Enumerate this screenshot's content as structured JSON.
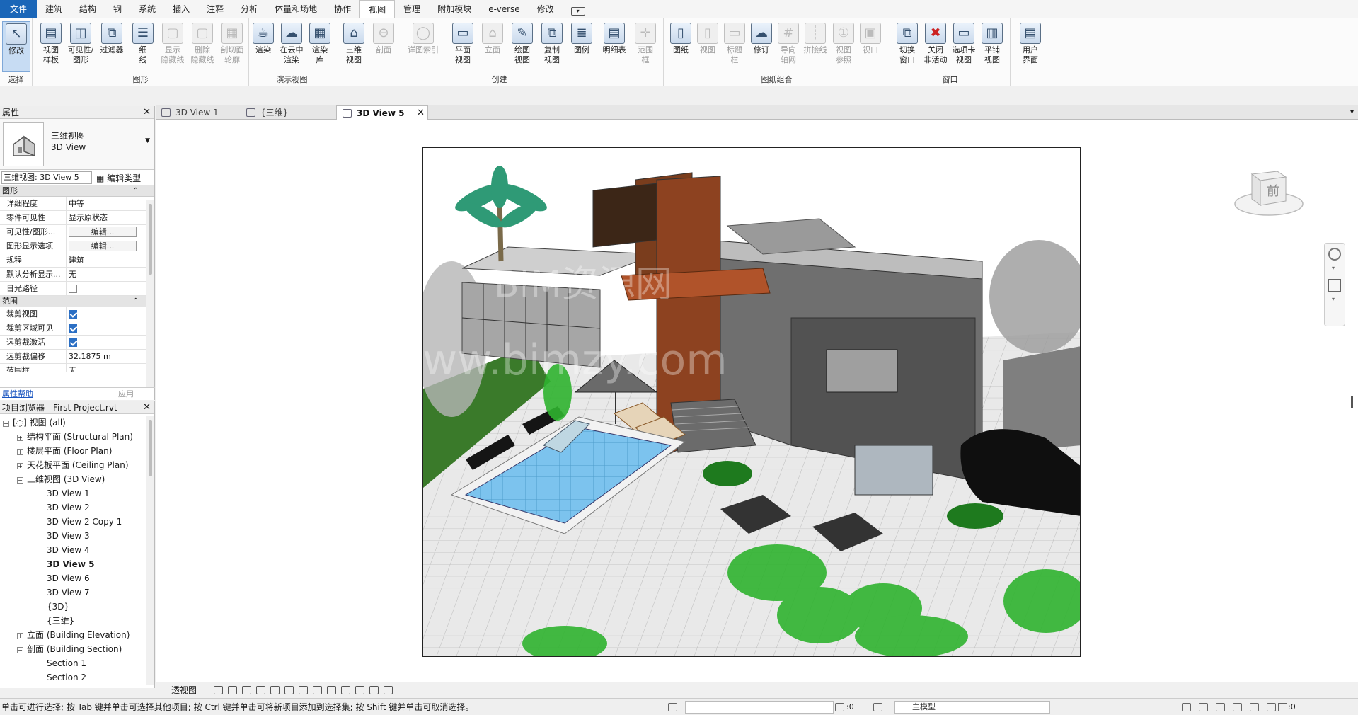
{
  "menu": {
    "file": "文件",
    "tabs": [
      "建筑",
      "结构",
      "钢",
      "系统",
      "插入",
      "注释",
      "分析",
      "体量和场地",
      "协作",
      "视图",
      "管理",
      "附加模块",
      "e-verse",
      "修改"
    ],
    "active": "视图"
  },
  "ribbon": {
    "buttons": [
      {
        "label": "修改",
        "sub": "",
        "icon": "cursor-icon"
      },
      {
        "label": "视图",
        "sub": "样板",
        "icon": "view-template-icon"
      },
      {
        "label": "可见性/",
        "sub": "图形",
        "icon": "visibility-graphics-icon"
      },
      {
        "label": "过滤器",
        "sub": "",
        "icon": "filters-icon"
      },
      {
        "label": "细",
        "sub": "线",
        "icon": "thin-lines-icon"
      },
      {
        "label": "显示",
        "sub": "隐藏线",
        "icon": "show-hidden-lines-icon"
      },
      {
        "label": "删除",
        "sub": "隐藏线",
        "icon": "remove-hidden-lines-icon"
      },
      {
        "label": "剖切面",
        "sub": "轮廓",
        "icon": "cut-profile-icon"
      },
      {
        "label": "渲染",
        "sub": "",
        "icon": "render-teapot-icon"
      },
      {
        "label": "在云中",
        "sub": "渲染",
        "icon": "cloud-render-icon"
      },
      {
        "label": "渲染",
        "sub": "库",
        "icon": "render-gallery-icon"
      },
      {
        "label": "三维",
        "sub": "视图",
        "icon": "3d-view-house-icon"
      },
      {
        "label": "剖面",
        "sub": "",
        "icon": "section-icon"
      },
      {
        "label": "详图索引",
        "sub": "",
        "icon": "callout-icon"
      },
      {
        "label": "平面",
        "sub": "视图",
        "icon": "plan-view-icon"
      },
      {
        "label": "立面",
        "sub": "",
        "icon": "elevation-icon"
      },
      {
        "label": "绘图",
        "sub": "视图",
        "icon": "drafting-view-icon"
      },
      {
        "label": "复制",
        "sub": "视图",
        "icon": "duplicate-view-icon"
      },
      {
        "label": "图例",
        "sub": "",
        "icon": "legend-icon"
      },
      {
        "label": "明细表",
        "sub": "",
        "icon": "schedule-icon"
      },
      {
        "label": "范围",
        "sub": "框",
        "icon": "scope-box-icon"
      },
      {
        "label": "图纸",
        "sub": "",
        "icon": "sheet-icon"
      },
      {
        "label": "视图",
        "sub": "",
        "icon": "place-view-icon"
      },
      {
        "label": "标题",
        "sub": "栏",
        "icon": "title-block-icon"
      },
      {
        "label": "修订",
        "sub": "",
        "icon": "revisions-icon"
      },
      {
        "label": "导向",
        "sub": "轴网",
        "icon": "guide-grid-icon"
      },
      {
        "label": "拼接线",
        "sub": "",
        "icon": "matchline-icon"
      },
      {
        "label": "视图",
        "sub": "参照",
        "icon": "view-reference-icon"
      },
      {
        "label": "视口",
        "sub": "",
        "icon": "viewports-icon"
      },
      {
        "label": "切换",
        "sub": "窗口",
        "icon": "switch-windows-icon"
      },
      {
        "label": "关闭",
        "sub": "非活动",
        "icon": "close-inactive-icon"
      },
      {
        "label": "选项卡",
        "sub": "视图",
        "icon": "tab-views-icon"
      },
      {
        "label": "平铺",
        "sub": "视图",
        "icon": "tile-views-icon"
      },
      {
        "label": "用户",
        "sub": "界面",
        "icon": "user-interface-icon"
      }
    ],
    "groups": [
      "选择",
      "图形",
      "演示视图",
      "创建",
      "图纸组合",
      "窗口"
    ]
  },
  "properties": {
    "title": "属性",
    "type_name_cn": "三维视图",
    "type_name_en": "3D View",
    "view_selector": "三维视图: 3D View 5",
    "edit_type": "编辑类型",
    "section_graphics": "图形",
    "graphics_rows": [
      {
        "name": "详细程度",
        "value": "中等"
      },
      {
        "name": "零件可见性",
        "value": "显示原状态"
      },
      {
        "name": "可见性/图形...",
        "value": "编辑..."
      },
      {
        "name": "图形显示选项",
        "value": "编辑..."
      },
      {
        "name": "规程",
        "value": "建筑"
      },
      {
        "name": "默认分析显示...",
        "value": "无"
      },
      {
        "name": "日光路径",
        "value": ""
      }
    ],
    "section_extents": "范围",
    "extents_rows": [
      {
        "name": "裁剪视图",
        "value": ""
      },
      {
        "name": "裁剪区域可见",
        "value": ""
      },
      {
        "name": "远剪裁激活",
        "value": ""
      },
      {
        "name": "远剪裁偏移",
        "value": "32.1875 m"
      },
      {
        "name": "范围框",
        "value": "无"
      }
    ],
    "help": "属性帮助",
    "apply": "应用"
  },
  "browser": {
    "title": "项目浏览器 - First Project.rvt",
    "nodes": [
      {
        "label": "视图 (all)"
      },
      {
        "label": "结构平面 (Structural Plan)"
      },
      {
        "label": "楼层平面 (Floor Plan)"
      },
      {
        "label": "天花板平面 (Ceiling Plan)"
      },
      {
        "label": "三维视图 (3D View)"
      },
      {
        "label": "3D View 1"
      },
      {
        "label": "3D View 2"
      },
      {
        "label": "3D View 2 Copy 1"
      },
      {
        "label": "3D View 3"
      },
      {
        "label": "3D View 4"
      },
      {
        "label": "3D View 5"
      },
      {
        "label": "3D View 6"
      },
      {
        "label": "3D View 7"
      },
      {
        "label": "{3D}"
      },
      {
        "label": "{三维}"
      },
      {
        "label": "立面 (Building Elevation)"
      },
      {
        "label": "剖面 (Building Section)"
      },
      {
        "label": "Section 1"
      },
      {
        "label": "Section 2"
      }
    ]
  },
  "doc_tabs": [
    {
      "label": "3D View 1"
    },
    {
      "label": "{三维}"
    },
    {
      "label": "3D View 5"
    }
  ],
  "viewcube": {
    "face": "前"
  },
  "watermark": {
    "line1": "BIM资源网",
    "line2": "www.bimzy.com"
  },
  "view_bar": {
    "mode": "透视图"
  },
  "status": {
    "text": "单击可进行选择; 按 Tab 键并单击可选择其他项目; 按 Ctrl 键并单击可将新项目添加到选择集; 按 Shift 键并单击可取消选择。",
    "selection_count": ":0",
    "model": "主模型",
    "filter_count": ":0"
  },
  "colors": {
    "accent": "#1a66b8",
    "selected": "#c7dcf3"
  }
}
